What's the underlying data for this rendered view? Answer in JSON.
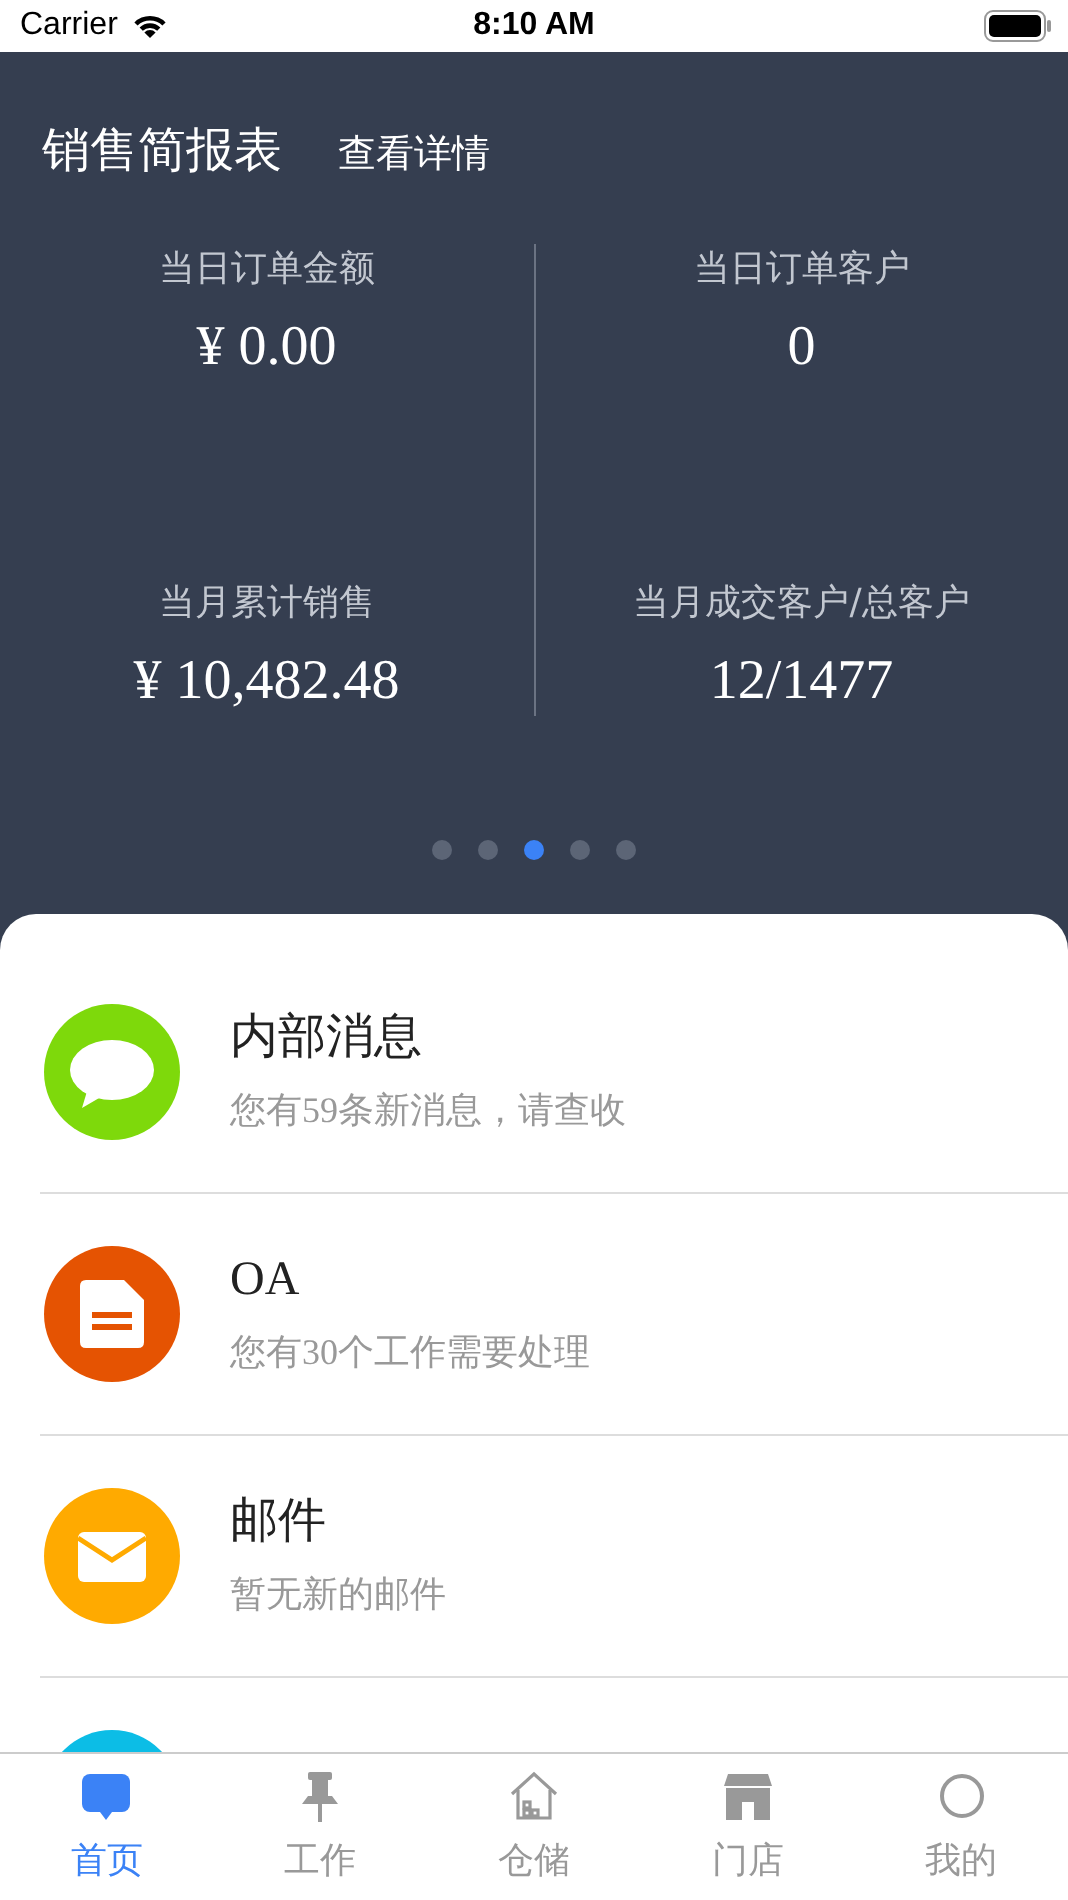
{
  "status_bar": {
    "carrier": "Carrier",
    "time": "8:10 AM"
  },
  "report": {
    "title": "销售简报表",
    "link": "查看详情",
    "stats": [
      {
        "label": "当日订单金额",
        "value": "¥ 0.00"
      },
      {
        "label": "当日订单客户",
        "value": "0"
      },
      {
        "label": "当月累计销售",
        "value": "¥ 10,482.48"
      },
      {
        "label": "当月成交客户/总客户",
        "value": "12/1477"
      }
    ],
    "pages": [
      {
        "selected": false
      },
      {
        "selected": false
      },
      {
        "selected": true
      },
      {
        "selected": false
      },
      {
        "selected": false
      }
    ]
  },
  "messages": [
    {
      "kind": "chat",
      "color": "#7ed90b",
      "title": "内部消息",
      "subtitle": "您有59条新消息，请查收"
    },
    {
      "kind": "doc",
      "color": "#e55302",
      "title": "OA",
      "subtitle": "您有30个工作需要处理"
    },
    {
      "kind": "mail",
      "color": "#ffaa00",
      "title": "邮件",
      "subtitle": "暂无新的邮件"
    },
    {
      "kind": "notice",
      "color": "#0cbde6"
    }
  ],
  "tabs": [
    {
      "kind": "home",
      "label": "首页",
      "selected": true
    },
    {
      "kind": "work",
      "label": "工作",
      "selected": false
    },
    {
      "kind": "storage",
      "label": "仓储",
      "selected": false
    },
    {
      "kind": "store",
      "label": "门店",
      "selected": false
    },
    {
      "kind": "me",
      "label": "我的",
      "selected": false
    }
  ]
}
